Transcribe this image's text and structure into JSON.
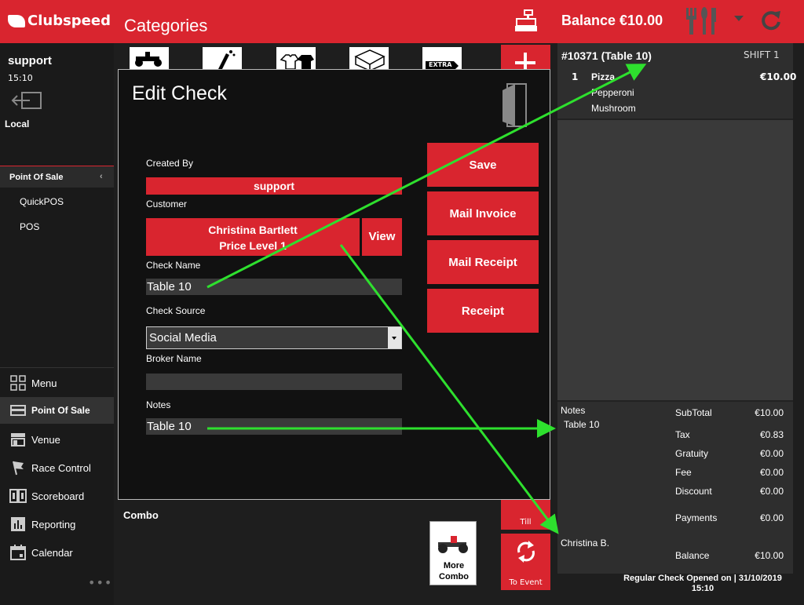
{
  "app": {
    "brand": "Clubspeed",
    "page_title": "Categories",
    "balance": "Balance €10.00"
  },
  "sidebar": {
    "user": "support",
    "time": "15:10",
    "location": "Local",
    "section": "Point Of Sale",
    "sub_items": [
      "QuickPOS",
      "POS"
    ],
    "nav": [
      "Menu",
      "Point Of Sale",
      "Venue",
      "Race Control",
      "Scoreboard",
      "Reporting",
      "Calendar"
    ],
    "more": "•••"
  },
  "categories": {
    "tiles": [
      "go-kart-icon",
      "champagne-icon",
      "t-shirt-icon",
      "gift-box-icon",
      "extra-tag-icon"
    ],
    "extra_label": "EXTRA"
  },
  "modal": {
    "title": "Edit Check",
    "created_by_label": "Created By",
    "created_by": "support",
    "customer_label": "Customer",
    "customer_name": "Christina Bartlett",
    "customer_level": "Price Level 1",
    "view_label": "View",
    "check_name_label": "Check Name",
    "check_name": "Table 10",
    "check_source_label": "Check Source",
    "check_source": "Social Media",
    "broker_label": "Broker Name",
    "broker": "",
    "notes_label": "Notes",
    "notes": "Table 10",
    "actions": [
      "Save",
      "Mail Invoice",
      "Mail Receipt",
      "Receipt"
    ]
  },
  "bottom": {
    "combo": "Combo",
    "more_combo_1": "More",
    "more_combo_2": "Combo",
    "till": "Till",
    "to_event": "To Event"
  },
  "order": {
    "check": "#10371  (Table 10)",
    "shift": "SHIFT 1",
    "line": {
      "qty": "1",
      "name": "Pizza",
      "price": "€10.00",
      "mods": [
        "Pepperoni",
        "Mushroom"
      ]
    },
    "notes_label": "Notes",
    "notes": "Table 10",
    "customer": "Christina B.",
    "totals": [
      {
        "label": "SubTotal",
        "value": "€10.00"
      },
      {
        "label": "Tax",
        "value": "€0.83"
      },
      {
        "label": "Gratuity",
        "value": "€0.00"
      },
      {
        "label": "Fee",
        "value": "€0.00"
      },
      {
        "label": "Discount",
        "value": "€0.00"
      },
      {
        "label": "Payments",
        "value": "€0.00"
      },
      {
        "label": "Balance",
        "value": "€10.00"
      }
    ],
    "footer_1": "Regular Check Opened on  |  31/10/2019",
    "footer_2": "15:10"
  },
  "colors": {
    "brand_red": "#d9252f",
    "annotation_green": "#2ee02e"
  }
}
